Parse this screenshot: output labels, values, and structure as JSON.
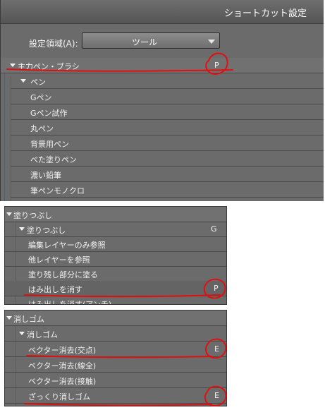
{
  "dialog": {
    "title": "ショートカット設定"
  },
  "domain": {
    "label": "設定領域(A):",
    "value": "ツール"
  },
  "panel1": {
    "rows": [
      {
        "label": "主力ペン・ブラシ",
        "key": "P"
      },
      {
        "label": "ペン",
        "key": ""
      },
      {
        "label": "Gペン",
        "key": ""
      },
      {
        "label": "Gペン試作",
        "key": ""
      },
      {
        "label": "丸ペン",
        "key": ""
      },
      {
        "label": "背景用ペン",
        "key": ""
      },
      {
        "label": "べた塗りペン",
        "key": ""
      },
      {
        "label": "濃い鉛筆",
        "key": ""
      },
      {
        "label": "筆ペンモノクロ",
        "key": ""
      }
    ]
  },
  "panel2": {
    "rows": [
      {
        "label": "塗りつぶし",
        "key": ""
      },
      {
        "label": "塗りつぶし",
        "key": "G"
      },
      {
        "label": "編集レイヤーのみ参照",
        "key": ""
      },
      {
        "label": "他レイヤーを参照",
        "key": ""
      },
      {
        "label": "塗り残し部分に塗る",
        "key": ""
      },
      {
        "label": "はみ出しを消す",
        "key": "P"
      },
      {
        "label": "はみ出しを消す(アンチ)",
        "key": ""
      }
    ]
  },
  "panel3": {
    "rows": [
      {
        "label": "消しゴム",
        "key": ""
      },
      {
        "label": "消しゴム",
        "key": ""
      },
      {
        "label": "ベクター消去(交点)",
        "key": "E"
      },
      {
        "label": "ベクター消去(線全)",
        "key": ""
      },
      {
        "label": "ベクター消去(接触)",
        "key": ""
      },
      {
        "label": "ざっくり消しゴム",
        "key": "E"
      }
    ]
  },
  "colors": {
    "panel": "#6b6b6b",
    "annotation": "#e01010"
  }
}
